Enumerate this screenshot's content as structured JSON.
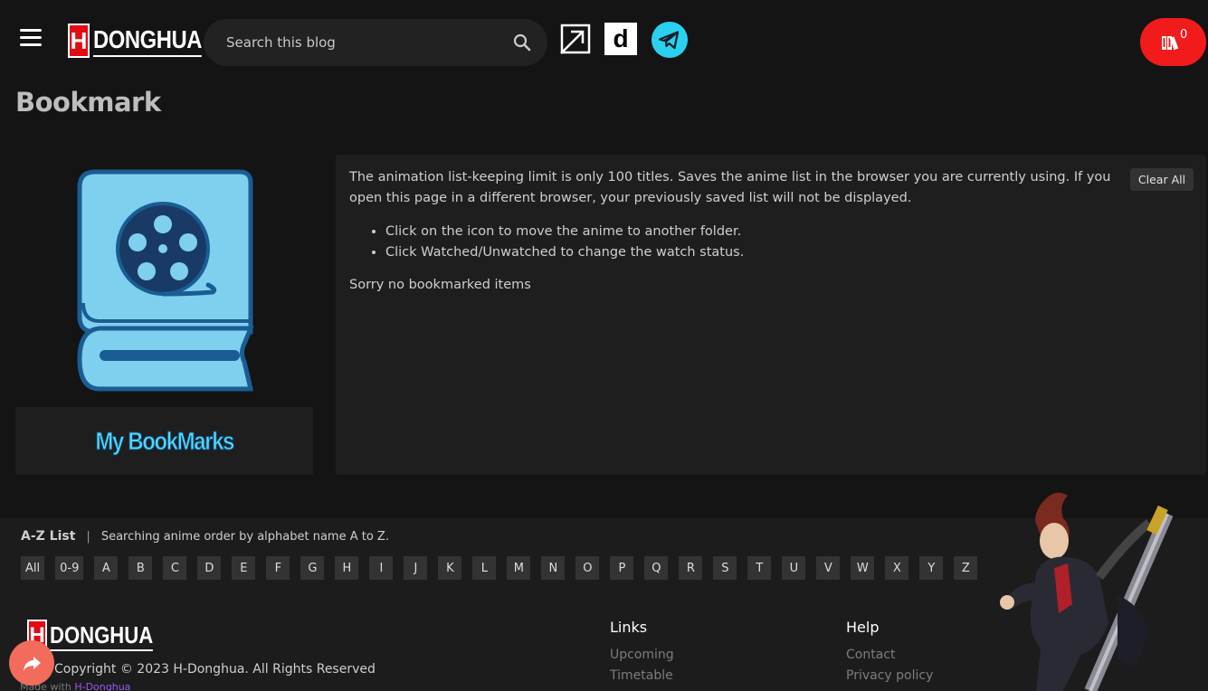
{
  "header": {
    "logo_letter": "H",
    "logo_text": "DONGHUA",
    "search_placeholder": "Search this blog",
    "d_icon_letter": "d",
    "bookmark_count": "0"
  },
  "page": {
    "title": "Bookmark"
  },
  "sidebar": {
    "banner_text": "My BookMarks"
  },
  "panel": {
    "description": "The animation list-keeping limit is only 100 titles. Saves the anime list in the browser you are currently using. If you open this page in a different browser, your previously saved list will not be displayed.",
    "tips": [
      "Click on the icon to move the anime to another folder.",
      "Click Watched/Unwatched to change the watch status."
    ],
    "empty_text": "Sorry no bookmarked items",
    "clear_label": "Clear All"
  },
  "az": {
    "title": "A-Z List",
    "separator": "|",
    "description": "Searching anime order by alphabet name A to Z.",
    "letters": [
      "All",
      "0-9",
      "A",
      "B",
      "C",
      "D",
      "E",
      "F",
      "G",
      "H",
      "I",
      "J",
      "K",
      "L",
      "M",
      "N",
      "O",
      "P",
      "Q",
      "R",
      "S",
      "T",
      "U",
      "V",
      "W",
      "X",
      "Y",
      "Z"
    ]
  },
  "footer": {
    "logo_letter": "H",
    "logo_text": "DONGHUA",
    "copyright": "Copyright © 2023 H-Donghua. All Rights Reserved",
    "made_with": "Made with",
    "made_link": "H-Donghua",
    "links_title": "Links",
    "links": [
      "Upcoming",
      "Timetable"
    ],
    "help_title": "Help",
    "help": [
      "Contact",
      "Privacy policy"
    ]
  },
  "colors": {
    "accent_red": "#f21b1b",
    "telegram": "#29b6e8",
    "book_blue": "#7fd0ef",
    "share": "#f26b5b"
  }
}
